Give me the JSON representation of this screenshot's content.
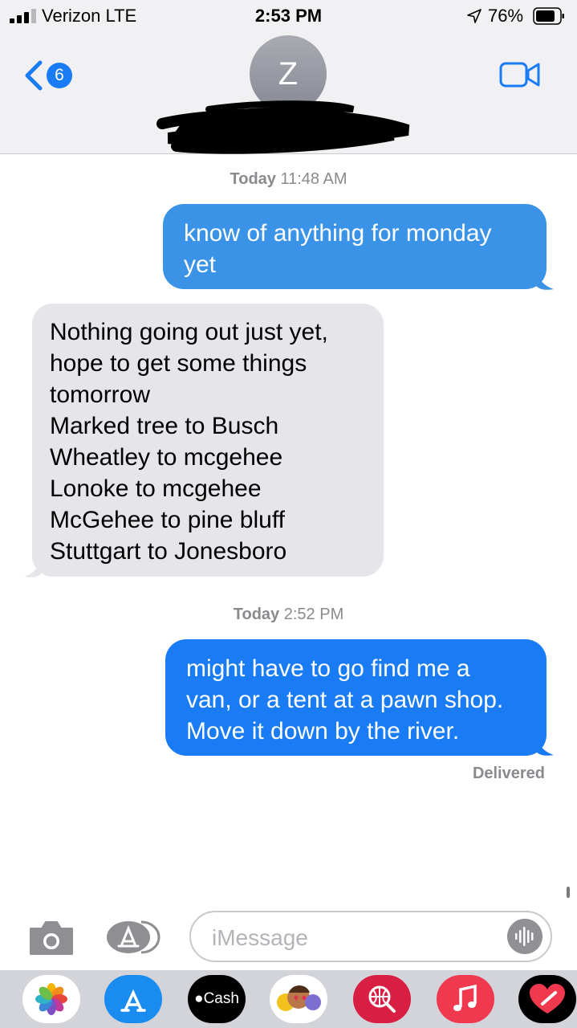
{
  "status_bar": {
    "carrier": "Verizon  LTE",
    "time": "2:53 PM",
    "battery": "76%"
  },
  "header": {
    "back_count": "6",
    "contact_initial": "Z"
  },
  "messages": {
    "timestamp_1_day": "Today",
    "timestamp_1_time": " 11:48 AM",
    "sent_1_lines": [
      "know of anything for monday",
      "yet"
    ],
    "received_lines": [
      "Nothing going out just yet,",
      "hope to get some things",
      "tomorrow",
      "Marked tree to Busch",
      "Wheatley to mcgehee",
      "Lonoke to mcgehee",
      "McGehee to pine bluff",
      "Stuttgart to Jonesboro"
    ],
    "timestamp_2_day": "Today",
    "timestamp_2_time": " 2:52 PM",
    "sent_2_lines": [
      "might have to go find me a",
      "van, or a tent at a pawn shop.",
      "Move it down by the river."
    ],
    "delivered": "Delivered"
  },
  "input": {
    "placeholder": "iMessage"
  },
  "app_drawer": {
    "apps": [
      "photos-icon",
      "app-store-icon",
      "apple-cash-icon",
      "memoji-icon",
      "web-search-icon",
      "music-icon",
      "digital-touch-icon"
    ],
    "cash_label": "Cash"
  },
  "colors": {
    "imessage_blue": "#1a7cf4",
    "sent_blue_light": "#3a93e6",
    "received_gray": "#e5e5ea",
    "header_bg": "#f1f1f3"
  }
}
